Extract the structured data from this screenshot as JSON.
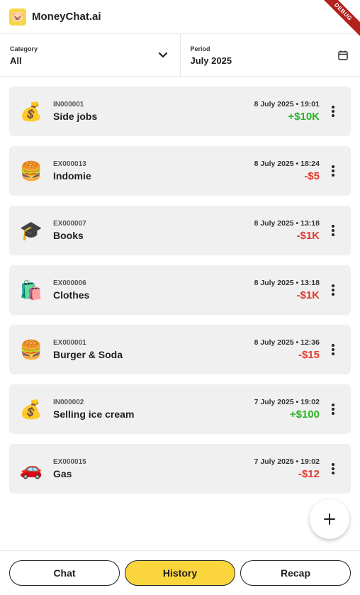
{
  "app": {
    "title": "MoneyChat.ai",
    "logo_emoji": "🐷",
    "debug_label": "DEBUG"
  },
  "filters": {
    "category": {
      "label": "Category",
      "value": "All",
      "icon": "chevron-down-icon"
    },
    "period": {
      "label": "Period",
      "value": "July 2025",
      "icon": "calendar-icon"
    }
  },
  "transactions": [
    {
      "emoji": "💰",
      "code": "IN000001",
      "name": "Side jobs",
      "datetime": "8 July 2025 • 19:01",
      "amount": "+$10K",
      "type": "income"
    },
    {
      "emoji": "🍔",
      "code": "EX000013",
      "name": "Indomie",
      "datetime": "8 July 2025 • 18:24",
      "amount": "-$5",
      "type": "expense"
    },
    {
      "emoji": "🎓",
      "code": "EX000007",
      "name": "Books",
      "datetime": "8 July 2025 • 13:18",
      "amount": "-$1K",
      "type": "expense"
    },
    {
      "emoji": "🛍️",
      "code": "EX000006",
      "name": "Clothes",
      "datetime": "8 July 2025 • 13:18",
      "amount": "-$1K",
      "type": "expense"
    },
    {
      "emoji": "🍔",
      "code": "EX000001",
      "name": "Burger & Soda",
      "datetime": "8 July 2025 • 12:36",
      "amount": "-$15",
      "type": "expense"
    },
    {
      "emoji": "💰",
      "code": "IN000002",
      "name": "Selling ice cream",
      "datetime": "7 July 2025 • 19:02",
      "amount": "+$100",
      "type": "income"
    },
    {
      "emoji": "🚗",
      "code": "EX000015",
      "name": "Gas",
      "datetime": "7 July 2025 • 19:02",
      "amount": "-$12",
      "type": "expense"
    }
  ],
  "fab": {
    "icon": "plus-icon"
  },
  "nav": {
    "chat": "Chat",
    "history": "History",
    "recap": "Recap",
    "active": "history"
  },
  "colors": {
    "accent": "#fad53c",
    "income": "#2ab327",
    "expense": "#e03a2e",
    "card_bg": "#f0f0f0"
  }
}
